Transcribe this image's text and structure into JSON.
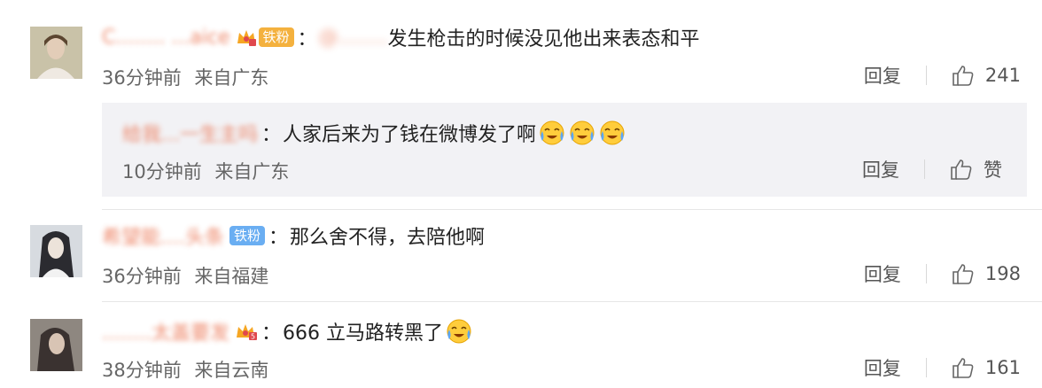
{
  "comments": [
    {
      "username": "C........ ...aice",
      "fan_badge": "铁粉",
      "mention": "@........",
      "text": "发生枪击的时候没见他出来表态和平",
      "time": "36分钟前",
      "location": "来自广东",
      "reply_label": "回复",
      "likes": "241",
      "sub_reply": {
        "username": "给我...一生主吗",
        "text": "人家后来为了钱在微博发了啊",
        "emoji": [
          "cry-laugh",
          "cry-laugh",
          "cry-laugh"
        ],
        "time": "10分钟前",
        "location": "来自广东",
        "reply_label": "回复",
        "like_label": "赞"
      }
    },
    {
      "username": "希望能....头条",
      "fan_badge": "铁粉",
      "text": "那么舍不得，去陪他啊",
      "time": "36分钟前",
      "location": "来自福建",
      "reply_label": "回复",
      "likes": "198"
    },
    {
      "username": "........太盖要发",
      "text": "666 立马路转黑了",
      "emoji": [
        "cry-laugh"
      ],
      "time": "38分钟前",
      "location": "来自云南",
      "reply_label": "回复",
      "likes": "161"
    }
  ]
}
